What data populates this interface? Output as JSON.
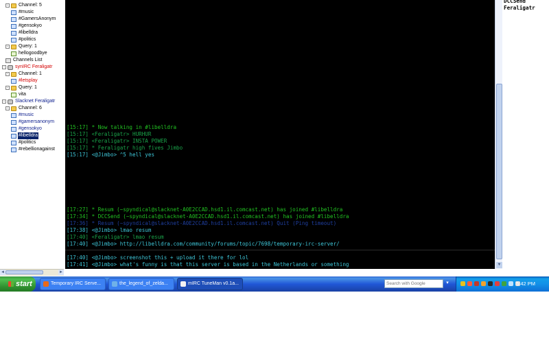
{
  "tree": {
    "items": [
      {
        "label": "Channel: 5",
        "type": "folder",
        "color": "",
        "depth": 1,
        "toggle": "-",
        "selected": false
      },
      {
        "label": "#music",
        "type": "chan",
        "color": "",
        "depth": 2,
        "toggle": "",
        "selected": false
      },
      {
        "label": "#GamersAnonym",
        "type": "chan",
        "color": "",
        "depth": 2,
        "toggle": "",
        "selected": false
      },
      {
        "label": "#gensokyo",
        "type": "chan",
        "color": "",
        "depth": 2,
        "toggle": "",
        "selected": false
      },
      {
        "label": "#libelldra",
        "type": "chan",
        "color": "",
        "depth": 2,
        "toggle": "",
        "selected": false
      },
      {
        "label": "#politics",
        "type": "chan",
        "color": "",
        "depth": 2,
        "toggle": "",
        "selected": false
      },
      {
        "label": "Query: 1",
        "type": "folder",
        "color": "",
        "depth": 1,
        "toggle": "-",
        "selected": false
      },
      {
        "label": "hellogoodbye",
        "type": "query",
        "color": "",
        "depth": 2,
        "toggle": "",
        "selected": false
      },
      {
        "label": "Channels List",
        "type": "list",
        "color": "",
        "depth": 1,
        "toggle": "",
        "selected": false
      },
      {
        "label": "synIRC Feraligatr",
        "type": "server",
        "color": "red",
        "depth": 0,
        "toggle": "-",
        "selected": false
      },
      {
        "label": "Channel: 1",
        "type": "folder",
        "color": "",
        "depth": 1,
        "toggle": "-",
        "selected": false
      },
      {
        "label": "#letsplay",
        "type": "chan",
        "color": "red",
        "depth": 2,
        "toggle": "",
        "selected": false
      },
      {
        "label": "Query: 1",
        "type": "folder",
        "color": "",
        "depth": 1,
        "toggle": "-",
        "selected": false
      },
      {
        "label": "vita",
        "type": "query",
        "color": "",
        "depth": 2,
        "toggle": "",
        "selected": false
      },
      {
        "label": "Slacknet Feraligatr",
        "type": "server",
        "color": "blue",
        "depth": 0,
        "toggle": "-",
        "selected": false
      },
      {
        "label": "Channel: 6",
        "type": "folder",
        "color": "",
        "depth": 1,
        "toggle": "-",
        "selected": false
      },
      {
        "label": "#music",
        "type": "chan",
        "color": "blue",
        "depth": 2,
        "toggle": "",
        "selected": false
      },
      {
        "label": "#gamersanonym",
        "type": "chan",
        "color": "blue",
        "depth": 2,
        "toggle": "",
        "selected": false
      },
      {
        "label": "#gensokyo",
        "type": "chan",
        "color": "blue",
        "depth": 2,
        "toggle": "",
        "selected": false
      },
      {
        "label": "#libelldra",
        "type": "chan",
        "color": "",
        "depth": 2,
        "toggle": "",
        "selected": true
      },
      {
        "label": "#politics",
        "type": "chan",
        "color": "",
        "depth": 2,
        "toggle": "",
        "selected": false
      },
      {
        "label": "#rebellionagainst",
        "type": "chan",
        "color": "",
        "depth": 2,
        "toggle": "",
        "selected": false
      }
    ]
  },
  "chat": {
    "lines": [
      {
        "text": "[15:17] * Now talking in #libelldra",
        "color": "#22c322"
      },
      {
        "text": "[15:17] <Feraligatr> HURHUR",
        "color": "#1aa34a"
      },
      {
        "text": "[15:17] <Feraligatr> INSTA POWER",
        "color": "#1aa34a"
      },
      {
        "text": "[15:17] * Feraligatr high fives Jimbo",
        "color": "#1aa34a"
      },
      {
        "text": "[15:17] <@Jimbo> ^5 hell yes",
        "color": "#3ec6d8"
      },
      {
        "text": "[17:27] * Resum (~spyndical@slacknet-A0E2CCAD.hsd1.il.comcast.net) has joined #libelldra",
        "color": "#22c322"
      },
      {
        "text": "[17:34] * DCCSend (~spyndical@slacknet-A0E2CCAD.hsd1.il.comcast.net) has joined #libelldra",
        "color": "#22c322"
      },
      {
        "text": "[17:36] * Resum (~spyndical@slacknet-A0E2CCAD.hsd1.il.comcast.net) Quit (Ping timeout)",
        "color": "#1f3fa0"
      },
      {
        "text": "[17:38] <@Jimbo> lmao resum",
        "color": "#3ec6d8"
      },
      {
        "text": "[17:40] <Feraligatr> lmao resum",
        "color": "#1aa34a"
      },
      {
        "text": "[17:40] <@Jimbo> http://libelldra.com/community/forums/topic/7698/temporary-irc-server/",
        "color": "#3ec6d8"
      }
    ]
  },
  "input": {
    "lines": [
      {
        "text": "[17:40] <@Jimbo> screenshot this + upload it there for lol",
        "color": "#3ec6d8"
      },
      {
        "text": "[17:41] <@Jimbo> what's funny is that this server is based in the Netherlands or something",
        "color": "#3ec6d8"
      }
    ]
  },
  "nicklist": {
    "nicks": [
      "DCCSend",
      "Feraligatr"
    ]
  },
  "taskbar": {
    "start_label": "start",
    "tasks": [
      {
        "label": "Temporary IRC Serve...",
        "active": false,
        "icon_color": "#e86a1c"
      },
      {
        "label": "the_legend_of_zelda...",
        "active": false,
        "icon_color": "#6fb1e8"
      },
      {
        "label": "mIRC TuneMan v0.1a...",
        "active": true,
        "icon_color": "#f2f2f2"
      }
    ],
    "search_placeholder": "Search with Google",
    "clock": "5:42 PM"
  }
}
